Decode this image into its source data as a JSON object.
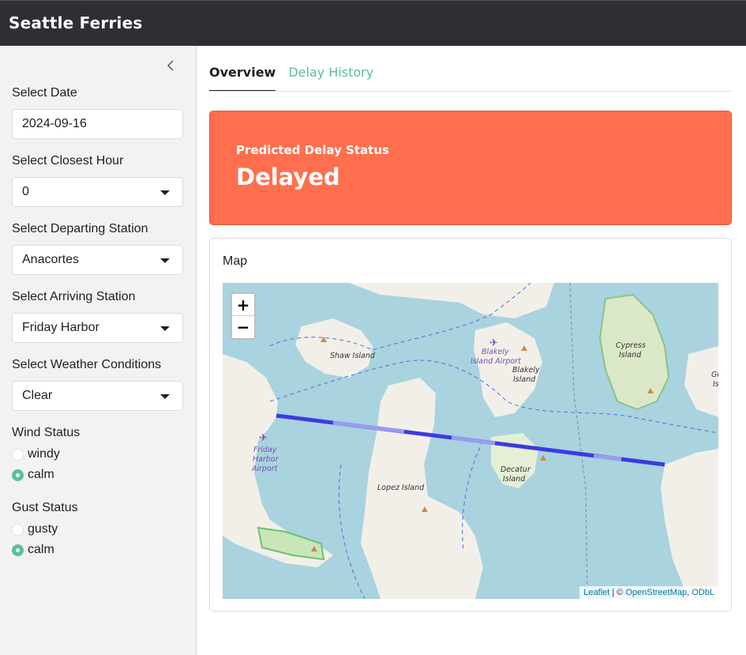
{
  "navbar": {
    "title": "Seattle Ferries"
  },
  "sidebar": {
    "date": {
      "label": "Select Date",
      "value": "2024-09-16"
    },
    "hour": {
      "label": "Select Closest Hour",
      "value": "0"
    },
    "departing": {
      "label": "Select Departing Station",
      "value": "Anacortes"
    },
    "arriving": {
      "label": "Select Arriving Station",
      "value": "Friday Harbor"
    },
    "weather": {
      "label": "Select Weather Conditions",
      "value": "Clear"
    },
    "wind": {
      "label": "Wind Status",
      "options": [
        "windy",
        "calm"
      ],
      "selected": "calm"
    },
    "gust": {
      "label": "Gust Status",
      "options": [
        "gusty",
        "calm"
      ],
      "selected": "calm"
    }
  },
  "tabs": [
    {
      "label": "Overview",
      "active": true
    },
    {
      "label": "Delay History",
      "active": false
    }
  ],
  "status": {
    "label": "Predicted Delay Status",
    "value": "Delayed",
    "color": "#ff6f4e"
  },
  "map": {
    "title": "Map",
    "zoom_in": "+",
    "zoom_out": "−",
    "attribution": {
      "leaflet": "Leaflet",
      "separator": " | © ",
      "osm": "OpenStreetMap",
      "comma": ", ",
      "odbl": "ODbL"
    },
    "places": {
      "shaw": "Shaw Island",
      "blakely_airport_1": "Blakely",
      "blakely_airport_2": "Island Airport",
      "blakely_1": "Blakely",
      "blakely_2": "Island",
      "cypress_1": "Cypress",
      "cypress_2": "Island",
      "friday_airport_1": "Friday",
      "friday_airport_2": "Harbor",
      "friday_airport_3": "Airport",
      "lopez": "Lopez Island",
      "decatur_1": "Decatur",
      "decatur_2": "Island",
      "edge_1": "Gu",
      "edge_2": "Is"
    }
  },
  "colors": {
    "accent": "#5bbd9f",
    "navbar": "#2d2f33",
    "water": "#a9d3de",
    "land": "#f2efe9",
    "route": "#3b3bdf"
  }
}
